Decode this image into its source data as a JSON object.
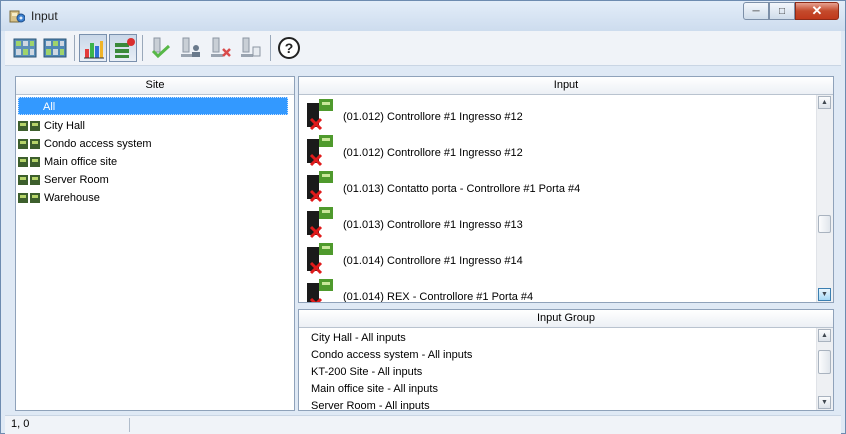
{
  "window": {
    "title": "Input"
  },
  "toolbar": {
    "buttons": [
      {
        "icon": "site-grid-icon",
        "pressed": false
      },
      {
        "icon": "site-grid-active-icon",
        "pressed": false
      },
      {
        "icon": "bar-chart-icon",
        "pressed": true
      },
      {
        "icon": "input-monitor-icon",
        "pressed": true
      },
      {
        "icon": "input-check-icon",
        "pressed": false
      },
      {
        "icon": "input-user-icon",
        "pressed": false
      },
      {
        "icon": "input-delete-icon",
        "pressed": false
      },
      {
        "icon": "input-edit-icon",
        "pressed": false
      },
      {
        "icon": "help-icon",
        "pressed": false
      }
    ]
  },
  "site_panel": {
    "header": "Site",
    "selected": "All",
    "items": [
      "City Hall",
      "Condo access system",
      "Main office site",
      "Server Room",
      "Warehouse"
    ]
  },
  "input_panel": {
    "header": "Input",
    "items": [
      "(01.012) Controllore #1 Ingresso #12",
      "(01.012) Controllore #1 Ingresso #12",
      "(01.013) Contatto porta - Controllore #1 Porta #4",
      "(01.013) Controllore #1 Ingresso #13",
      "(01.014) Controllore #1 Ingresso #14",
      "(01.014) REX - Controllore #1 Porta #4"
    ]
  },
  "input_group_panel": {
    "header": "Input Group",
    "items": [
      "City Hall - All inputs",
      "Condo access system - All inputs",
      "KT-200 Site - All inputs",
      "Main office site - All inputs",
      "Server Room - All inputs"
    ]
  },
  "statusbar": {
    "position": "1, 0"
  },
  "colors": {
    "selection": "#3399ff",
    "close_button": "#c44a2c",
    "window_frame": "#dfe9f5"
  }
}
